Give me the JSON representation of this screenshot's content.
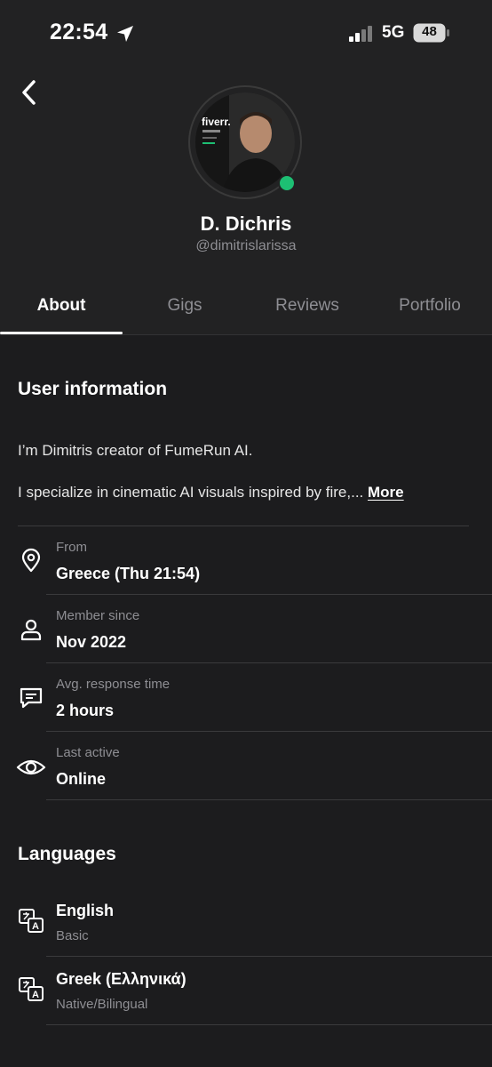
{
  "status_bar": {
    "time": "22:54",
    "network": "5G",
    "battery": "48"
  },
  "profile": {
    "name": "D. Dichris",
    "handle": "@dimitrislarissa",
    "avatar_logo": "fiverr."
  },
  "tabs": [
    {
      "label": "About",
      "active": true
    },
    {
      "label": "Gigs",
      "active": false
    },
    {
      "label": "Reviews",
      "active": false
    },
    {
      "label": "Portfolio",
      "active": false
    }
  ],
  "user_info": {
    "heading": "User information",
    "intro": "I’m Dimitris creator of FumeRun AI.",
    "specialty": "I specialize in cinematic AI visuals inspired by fire,...",
    "more_label": "More"
  },
  "details": [
    {
      "icon": "location-pin-icon",
      "label": "From",
      "value": "Greece (Thu 21:54)"
    },
    {
      "icon": "person-icon",
      "label": "Member since",
      "value": "Nov 2022"
    },
    {
      "icon": "chat-bubble-icon",
      "label": "Avg. response time",
      "value": "2 hours"
    },
    {
      "icon": "eye-icon",
      "label": "Last active",
      "value": "Online"
    }
  ],
  "languages": {
    "heading": "Languages",
    "items": [
      {
        "name": "English",
        "level": "Basic"
      },
      {
        "name": "Greek (Ελληνικά)",
        "level": "Native/Bilingual"
      }
    ]
  },
  "colors": {
    "background": "#1c1c1e",
    "online": "#1dbf73",
    "muted": "#8e8e93"
  }
}
